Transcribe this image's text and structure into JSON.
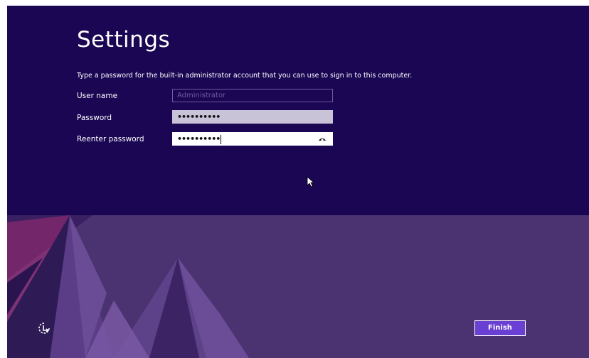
{
  "page": {
    "title": "Settings",
    "instruction": "Type a password for the built-in administrator account that you can use to sign in to this computer."
  },
  "form": {
    "username_label": "User name",
    "username_placeholder": "Administrator",
    "password_label": "Password",
    "password_value": "••••••••••",
    "reenter_label": "Reenter password",
    "reenter_value": "••••••••••"
  },
  "footer": {
    "finish_label": "Finish"
  },
  "icons": {
    "reveal": "eye-icon",
    "ease_of_access": "ease-of-access-icon",
    "cursor": "mouse-pointer-icon"
  },
  "colors": {
    "top_background": "#1a0653",
    "bottom_background": "#4b3271",
    "accent_button": "#6a3fd4"
  }
}
